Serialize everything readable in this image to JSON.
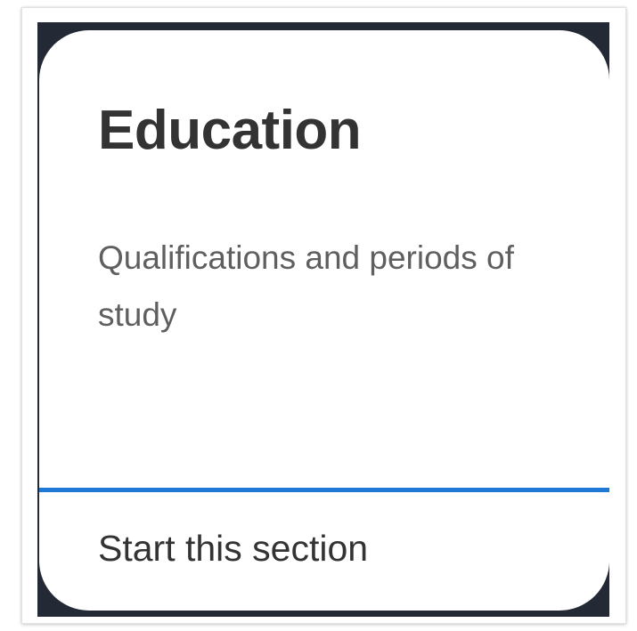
{
  "section_card": {
    "title": "Education",
    "description": "Qualifications and periods of study",
    "action_label": "Start this section",
    "colors": {
      "backdrop": "#232a35",
      "card": "#ffffff",
      "accent": "#1e78d4",
      "title_text": "#333333",
      "description_text": "#5f5f5f"
    }
  }
}
